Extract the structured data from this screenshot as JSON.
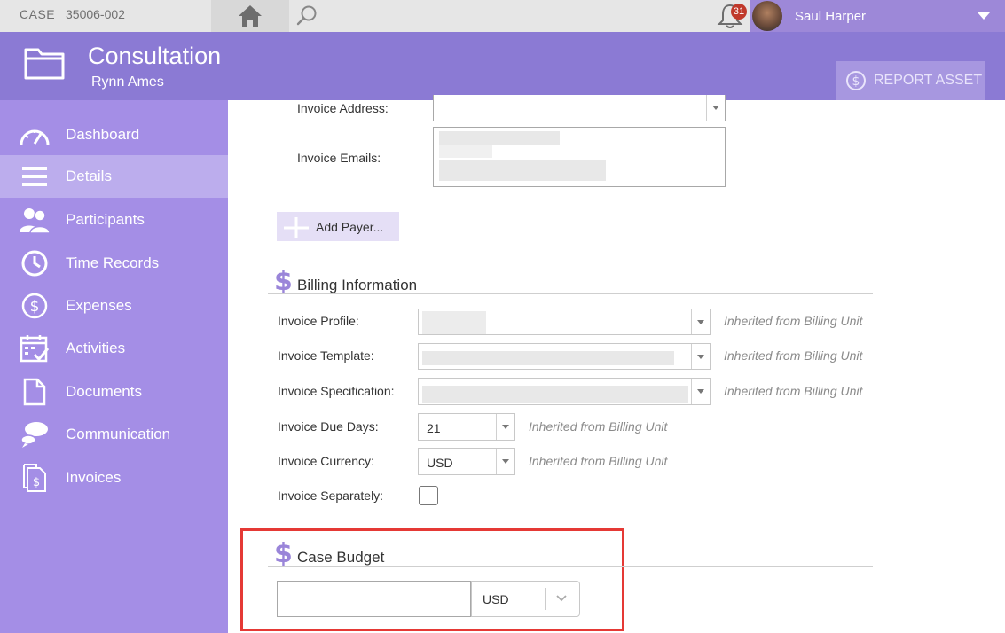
{
  "topbar": {
    "case_label": "CASE",
    "case_number": "35006-002",
    "notification_count": "31",
    "user_name": "Saul Harper"
  },
  "header": {
    "title": "Consultation",
    "subtitle": "Rynn Ames",
    "report_button": "REPORT ASSET"
  },
  "sidebar": {
    "items": [
      {
        "label": "Dashboard",
        "icon": "speedometer-icon"
      },
      {
        "label": "Details",
        "icon": "list-icon",
        "active": true
      },
      {
        "label": "Participants",
        "icon": "people-icon"
      },
      {
        "label": "Time Records",
        "icon": "clock-icon"
      },
      {
        "label": "Expenses",
        "icon": "dollar-circle-icon"
      },
      {
        "label": "Activities",
        "icon": "calendar-check-icon"
      },
      {
        "label": "Documents",
        "icon": "document-icon"
      },
      {
        "label": "Communication",
        "icon": "chat-bubbles-icon"
      },
      {
        "label": "Invoices",
        "icon": "invoice-icon"
      }
    ]
  },
  "payer": {
    "invoice_address_label": "Invoice Address:",
    "invoice_emails_label": "Invoice Emails:",
    "add_payer_button": "Add Payer..."
  },
  "billing": {
    "section_title": "Billing Information",
    "profile_label": "Invoice Profile:",
    "template_label": "Invoice Template:",
    "specification_label": "Invoice Specification:",
    "due_days_label": "Invoice Due Days:",
    "due_days_value": "21",
    "currency_label": "Invoice Currency:",
    "currency_value": "USD",
    "separately_label": "Invoice Separately:",
    "inherited_text": "Inherited from Billing Unit"
  },
  "budget": {
    "section_title": "Case Budget",
    "amount_value": "",
    "currency_value": "USD"
  },
  "colors": {
    "header": "#8b7ad4",
    "sidebar": "#a48ee6",
    "sidebar_active": "#bcaded",
    "accent_dollar": "#9a85d9",
    "highlight_border": "#e53935"
  }
}
